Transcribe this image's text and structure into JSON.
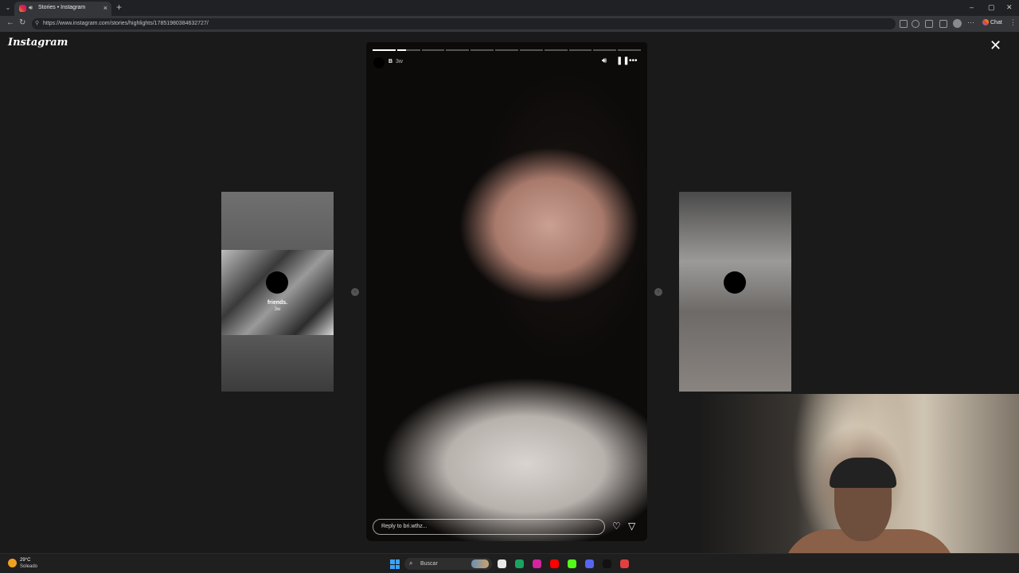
{
  "browser": {
    "tab_title": "Stories • Instagram",
    "tab_close": "×",
    "new_tab": "+",
    "url": "https://www.instagram.com/stories/highlights/17851980384632727/",
    "chat_label": "Chat",
    "window_minimize": "–",
    "window_maximize": "▢",
    "window_close": "✕"
  },
  "viewer": {
    "logo": "Instagram",
    "close_glyph": "✕",
    "main_story": {
      "progress": {
        "segments": 11,
        "current_index": 1,
        "current_fill": 0.4
      },
      "username": "B",
      "time": "3w",
      "reply_placeholder": "Reply to bri.wthz...",
      "like_glyph": "♡",
      "share_glyph": "▽"
    },
    "prev_story": {
      "name": "friends.",
      "time": "3w"
    },
    "next_story": {
      "name": "",
      "time": ""
    },
    "arrow_left": "‹",
    "arrow_right": "›"
  },
  "taskbar": {
    "weather_temp": "29°C",
    "weather_condition": "Soleado",
    "search_label": "Buscar",
    "apps": [
      {
        "name": "explorer",
        "color": "#e8e8e8"
      },
      {
        "name": "chrome",
        "color": "#1aa260"
      },
      {
        "name": "instagram",
        "color": "#d6249f"
      },
      {
        "name": "youtube",
        "color": "#ff0000"
      },
      {
        "name": "kick",
        "color": "#53fc18"
      },
      {
        "name": "discord",
        "color": "#5865f2"
      },
      {
        "name": "tiktok",
        "color": "#111111"
      },
      {
        "name": "recorder",
        "color": "#e04040"
      }
    ]
  }
}
